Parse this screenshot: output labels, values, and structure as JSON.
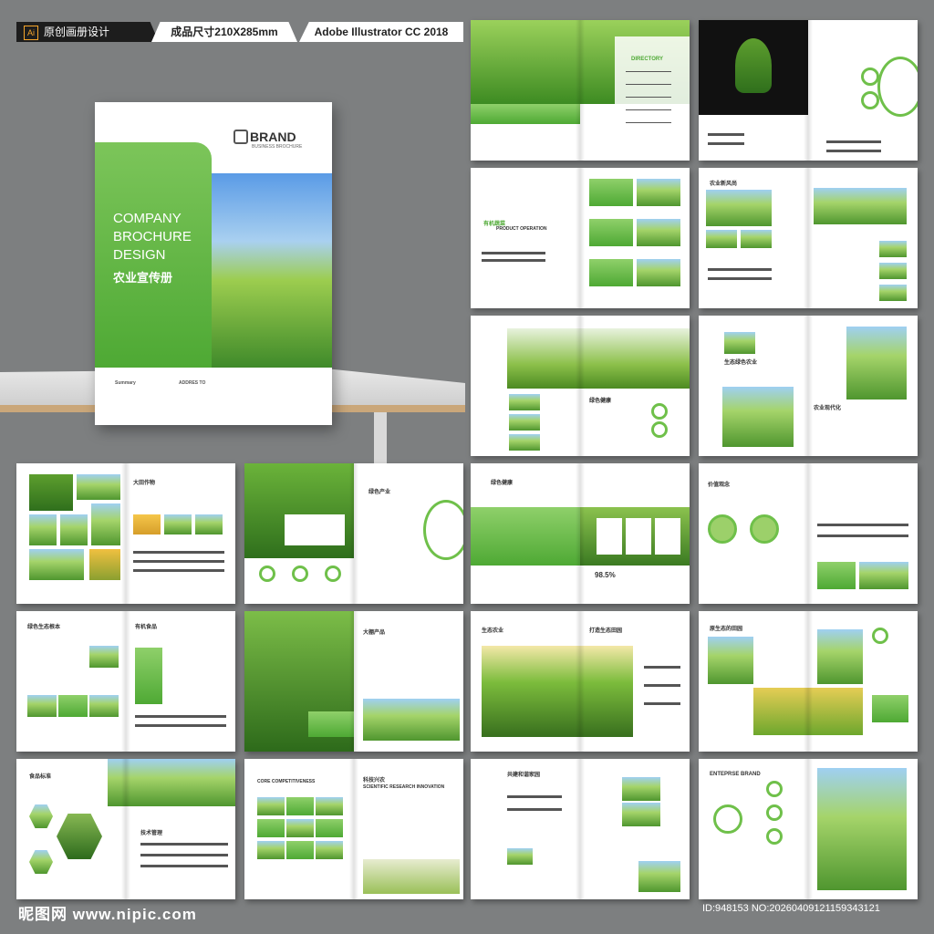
{
  "header": {
    "ai_badge": "Ai",
    "label1": "原创画册设计",
    "label2": "成品尺寸210X285mm",
    "label3": "Adobe Illustrator CC 2018"
  },
  "cover": {
    "brand": "BRAND",
    "brand_sub": "BUSINESS BROCHURE",
    "title_en": "COMPANY BROCHURE DESIGN",
    "title_cn": "农业宣传册",
    "summary": "Summary",
    "address": "ADDRES TO"
  },
  "pages": {
    "directory": "DIRECTORY",
    "organic": "有机蔬菜",
    "product_operation": "PRODUCT OPERATION",
    "news": "农业新风尚",
    "field_crops": "大田作物",
    "green_industry": "绿色产业",
    "green_health": "绿色健康",
    "value": "价值观念",
    "green_eco": "绿色生态根本",
    "organic_food": "有机食品",
    "big_shed": "大棚产品",
    "eco_agri": "生态农业",
    "build_eco": "打造生态田园",
    "eco_origin": "原生态的田园",
    "food_standard": "食品标准",
    "tech_mgmt": "技术管理",
    "core_comp": "CORE COMPETITIVENESS",
    "sci_agri": "科技兴农",
    "sci_research": "SCIENTIFIC RESEARCH INNOVATION",
    "build_home": "共建和谐家园",
    "green_health2": "绿色健康",
    "enterprise_brand": "ENTEPRSE BRAND",
    "eco_green_agri": "生态绿色农业",
    "modern_agri": "农业现代化",
    "percent": "98.5%"
  },
  "footer": {
    "site": "昵图网 www.nipic.com",
    "id": "ID:948153 NO:20260409121159343121"
  }
}
